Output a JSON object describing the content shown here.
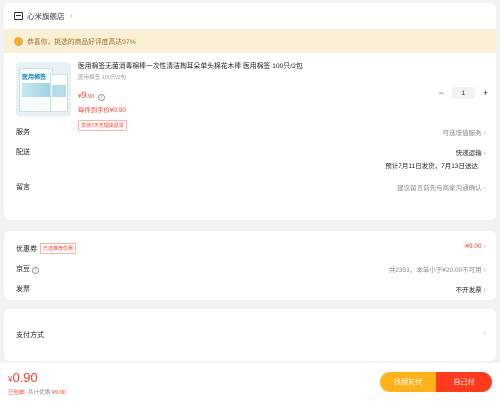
{
  "shop": {
    "name": "心米旗舰店",
    "chevron": "›",
    "banner": "恭喜你，挑选的商品好评度高达97%"
  },
  "product": {
    "image_title": "医用棉签",
    "title": "医用棉签无菌消毒棉棒一次性清洁掏耳朵单头棉花木棒 医用棉签 100只/2包",
    "spec": "医用棉签 100只/2包",
    "price_yen": "¥",
    "price_int": "9",
    "price_dec": ".90",
    "each_price": "每件到手价¥0.90",
    "tag": "支持7天无理由退货",
    "quantity": "1",
    "minus": "−",
    "plus": "+"
  },
  "rows": {
    "service_label": "服务",
    "service_value": "可选增值服务",
    "delivery_label": "配送",
    "delivery_value": "快递运输",
    "delivery_eta": "预计7月11日发货，7月13日送达",
    "note_label": "留言",
    "note_placeholder": "建议留言前先与商家沟通确认"
  },
  "discount": {
    "coupon_label": "优惠券",
    "coupon_badge": "已选推荐优惠",
    "coupon_value": "-¥9.00",
    "jingdou_label": "京豆",
    "jingdou_value": "共2353，本单小于¥20.00不可用",
    "invoice_label": "发票",
    "invoice_value": "不开发票"
  },
  "payment": {
    "label": "支付方式"
  },
  "footer": {
    "yen": "¥",
    "amount": "0.90",
    "shipping": "已包邮",
    "discount_prefix": "共计优惠",
    "discount_value": "¥9.00",
    "friend_pay": "找朋友付",
    "self_pay": "自己付"
  },
  "colors": {
    "accent": "#ff3d2b",
    "banner_bg": "#fbf0d6",
    "friend_btn": "#ffb21b",
    "self_btn": "#ff3a1f"
  }
}
